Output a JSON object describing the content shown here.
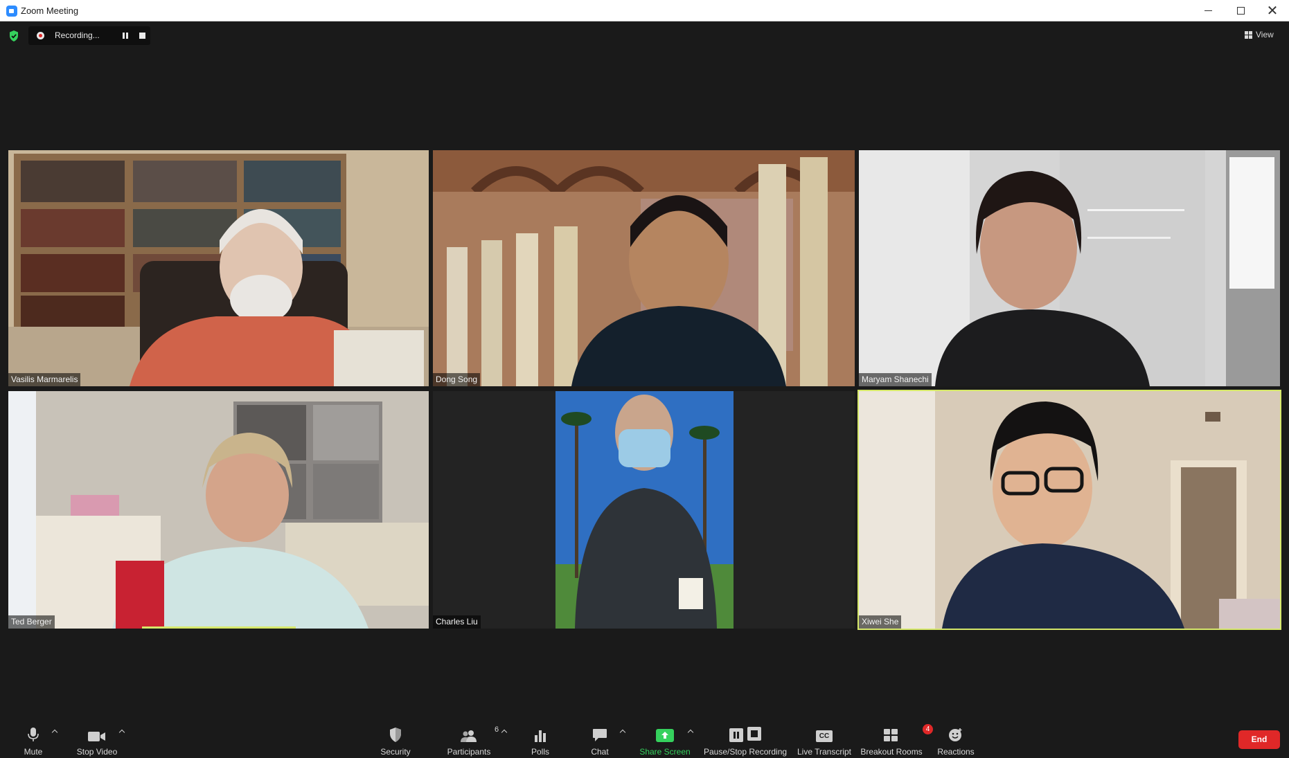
{
  "window": {
    "title": "Zoom Meeting",
    "minimize_icon": "minimize-icon",
    "maximize_icon": "maximize-icon",
    "close_glyph": "✕"
  },
  "overlay": {
    "security_status_icon": "shield-check-icon",
    "recording_status": "Recording...",
    "view_label": "View"
  },
  "participants": [
    {
      "name": "Vasilis Marmarelis",
      "active_speaker": false
    },
    {
      "name": "Dong Song",
      "active_speaker": false
    },
    {
      "name": "Maryam Shanechi",
      "active_speaker": false
    },
    {
      "name": "Ted Berger",
      "active_speaker": false
    },
    {
      "name": "Charles Liu",
      "active_speaker": false
    },
    {
      "name": "Xiwei She",
      "active_speaker": true
    }
  ],
  "toolbar": {
    "mute_label": "Mute",
    "stop_video_label": "Stop Video",
    "security_label": "Security",
    "participants_label": "Participants",
    "participants_count": "6",
    "polls_label": "Polls",
    "chat_label": "Chat",
    "share_screen_label": "Share Screen",
    "pause_stop_recording_label": "Pause/Stop Recording",
    "live_transcript_label": "Live Transcript",
    "live_transcript_icon_text": "CC",
    "breakout_rooms_label": "Breakout Rooms",
    "breakout_rooms_badge": "4",
    "reactions_label": "Reactions",
    "end_label": "End"
  },
  "colors": {
    "accent_green": "#35d15d",
    "active_speaker_border": "#d6e86a",
    "end_red": "#e02828",
    "background": "#1a1a1a"
  }
}
